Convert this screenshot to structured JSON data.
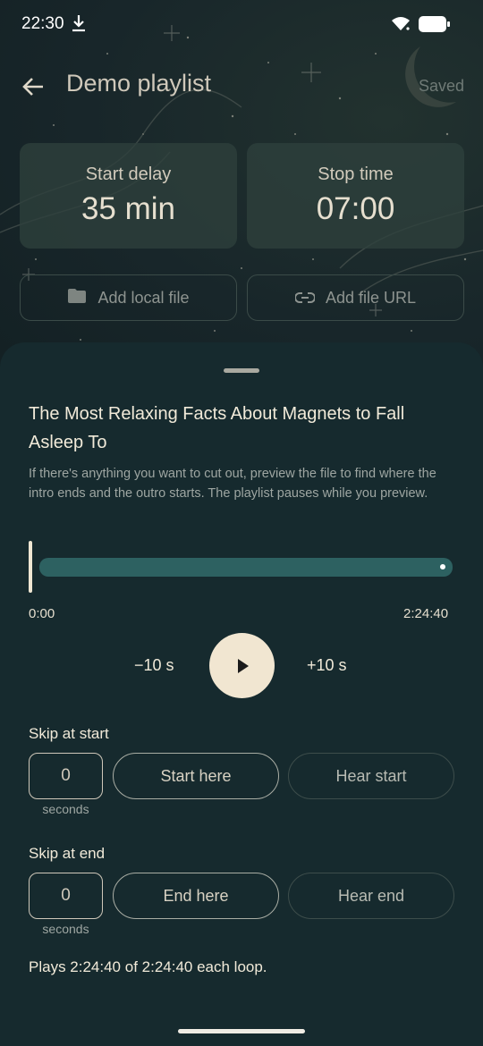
{
  "status_bar": {
    "time": "22:30"
  },
  "app_bar": {
    "title": "Demo playlist",
    "saved_label": "Saved"
  },
  "cards": {
    "start_delay": {
      "label": "Start delay",
      "value": "35 min"
    },
    "stop_time": {
      "label": "Stop time",
      "value": "07:00"
    }
  },
  "actions": {
    "add_local_file": "Add local file",
    "add_file_url": "Add file URL"
  },
  "sheet": {
    "file_title": "The Most Relaxing Facts About Magnets to Fall Asleep To",
    "hint": "If there's anything you want to cut out, preview the file to find where the intro ends and the outro starts. The playlist pauses while you preview.",
    "position_start": "0:00",
    "position_end": "2:24:40",
    "seek_back": "−10 s",
    "seek_forward": "+10 s",
    "skip_start": {
      "heading": "Skip at start",
      "value": "0",
      "unit": "seconds",
      "set_button": "Start here",
      "hear_button": "Hear start"
    },
    "skip_end": {
      "heading": "Skip at end",
      "value": "0",
      "unit": "seconds",
      "set_button": "End here",
      "hear_button": "Hear end"
    },
    "summary": "Plays 2:24:40 of 2:24:40 each loop."
  },
  "colors": {
    "accent_track": "#2d6161",
    "play_button": "#f1e6d1",
    "sheet_bg": "#162a2e"
  }
}
